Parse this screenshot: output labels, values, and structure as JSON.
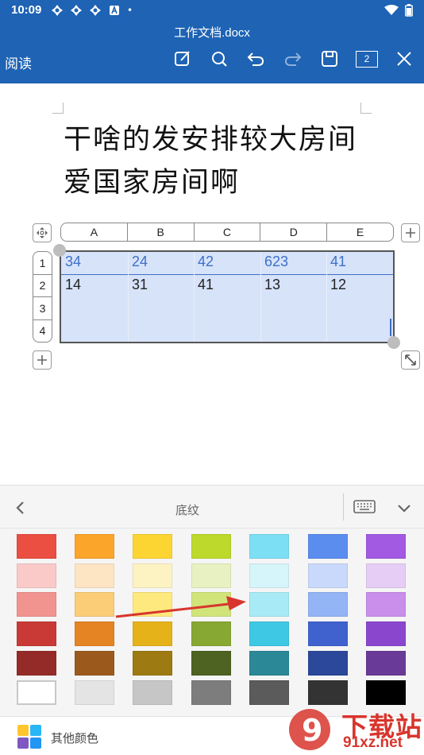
{
  "status_bar": {
    "time": "10:09",
    "dot": "•"
  },
  "app_bar": {
    "title": "工作文档.docx",
    "read_label": "阅读",
    "page_count": "2"
  },
  "document": {
    "heading": "干啥的发安排较大房间爱国家房间啊",
    "columns": [
      "A",
      "B",
      "C",
      "D",
      "E"
    ],
    "rows": [
      "1",
      "2",
      "3",
      "4"
    ],
    "table": [
      [
        "34",
        "24",
        "42",
        "623",
        "41"
      ],
      [
        "14",
        "31",
        "41",
        "13",
        "12"
      ]
    ]
  },
  "panel": {
    "title": "底纹",
    "more_colors_label": "其他颜色",
    "swatches": [
      [
        "#ea4f42",
        "#fba52a",
        "#fdd533",
        "#bcd92c",
        "#7ddff4",
        "#5b8def",
        "#a25ae3"
      ],
      [
        "#f9cac8",
        "#fde4c3",
        "#fdf2c2",
        "#e8f1c1",
        "#d6f5fb",
        "#c9d9fb",
        "#e5cdf5"
      ],
      [
        "#f1938f",
        "#fbcd77",
        "#fde97d",
        "#d1e47a",
        "#a8ebf6",
        "#93b4f5",
        "#c98feb"
      ],
      [
        "#c93a36",
        "#e58423",
        "#e6b21a",
        "#88a834",
        "#3ec8e4",
        "#3f62cf",
        "#8a47ce"
      ],
      [
        "#952b28",
        "#9b5a1c",
        "#9d7a12",
        "#4e6322",
        "#2b8897",
        "#2c489a",
        "#6a3a98"
      ],
      [
        "#ffffff",
        "#e4e4e4",
        "#c6c6c6",
        "#7d7d7d",
        "#5b5b5b",
        "#333333",
        "#000000"
      ]
    ]
  },
  "watermark": {
    "brand": "下载站",
    "domain": "91xz.net",
    "logo_text": "9"
  },
  "colors": {
    "appbar": "#1e63b4",
    "table_fill": "#d7e3f9",
    "first_row_text": "#3d6fc8",
    "arrow": "#d8352d"
  }
}
